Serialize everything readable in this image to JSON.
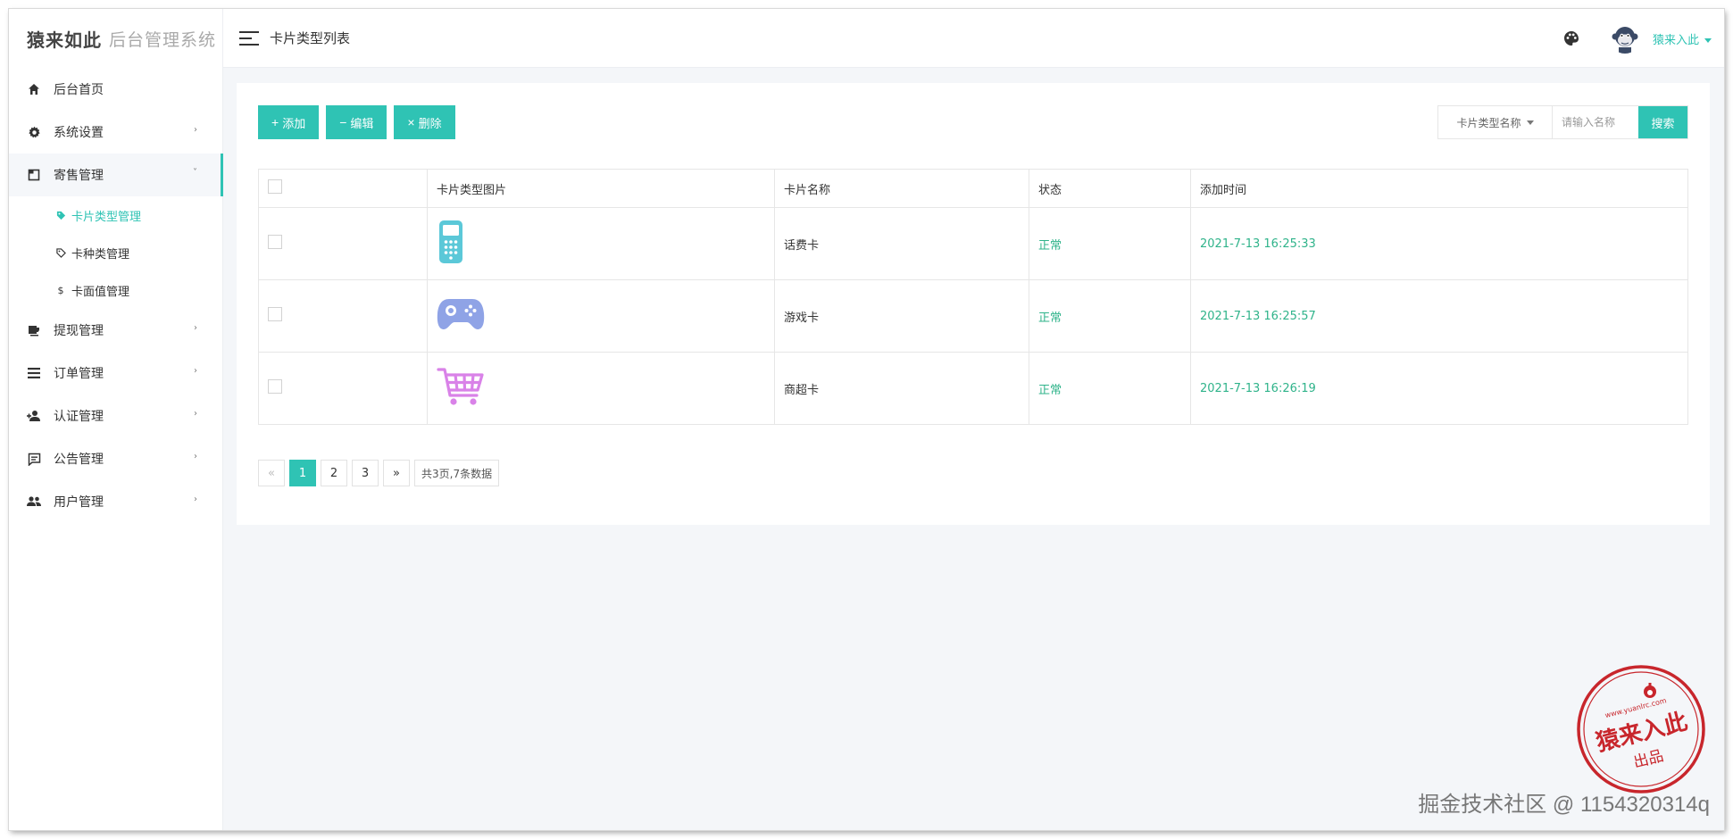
{
  "sidebar": {
    "logo": "猿来如此",
    "system_name": "后台管理系统",
    "menu": [
      {
        "label": "后台首页",
        "icon": "home-icon"
      },
      {
        "label": "系统设置",
        "icon": "gear-icon",
        "arrow": "›"
      },
      {
        "label": "寄售管理",
        "icon": "consign-icon",
        "arrow": "˅"
      },
      {
        "label": "提现管理",
        "icon": "withdraw-icon",
        "arrow": "›"
      },
      {
        "label": "订单管理",
        "icon": "list-icon",
        "arrow": "›"
      },
      {
        "label": "认证管理",
        "icon": "user-plus-icon",
        "arrow": "›"
      },
      {
        "label": "公告管理",
        "icon": "announcement-icon",
        "arrow": "›"
      },
      {
        "label": "用户管理",
        "icon": "users-icon",
        "arrow": "›"
      }
    ],
    "submenu": [
      {
        "label": "卡片类型管理",
        "icon": "tag-icon"
      },
      {
        "label": "卡种类管理",
        "icon": "tag-outline-icon"
      },
      {
        "label": "卡面值管理",
        "icon": "dollar-icon",
        "glyph": "$"
      }
    ]
  },
  "topbar": {
    "page_title": "卡片类型列表",
    "user_name": "猿来入此"
  },
  "toolbar": {
    "add_label": "添加",
    "add_glyph": "+",
    "edit_label": "编辑",
    "edit_glyph": "−",
    "delete_label": "删除",
    "delete_glyph": "×"
  },
  "search": {
    "field_label": "卡片类型名称",
    "placeholder": "请输入名称",
    "button_label": "搜索"
  },
  "table": {
    "headers": [
      "",
      "卡片类型图片",
      "卡片名称",
      "状态",
      "添加时间"
    ],
    "rows": [
      {
        "image": "phone-icon",
        "name": "话费卡",
        "status": "正常",
        "time": "2021-7-13 16:25:33"
      },
      {
        "image": "gamepad-icon",
        "name": "游戏卡",
        "status": "正常",
        "time": "2021-7-13 16:25:57"
      },
      {
        "image": "cart-icon",
        "name": "商超卡",
        "status": "正常",
        "time": "2021-7-13 16:26:19"
      }
    ]
  },
  "pagination": {
    "prev": "«",
    "pages": [
      "1",
      "2",
      "3"
    ],
    "current": "1",
    "next": "»",
    "summary": "共3页,7条数据"
  },
  "stamp": {
    "text": "猿来入此",
    "sub": "出品",
    "url": "www.yuanlrc.com"
  },
  "watermark": "掘金技术社区 @ 1154320314q",
  "colors": {
    "accent": "#2fc3b4",
    "status_green": "#2fb38a",
    "phone_icon": "#5bc8d8",
    "gamepad_icon": "#8fa3e6",
    "cart_icon": "#d982e8",
    "stamp_red": "#c8262c"
  }
}
